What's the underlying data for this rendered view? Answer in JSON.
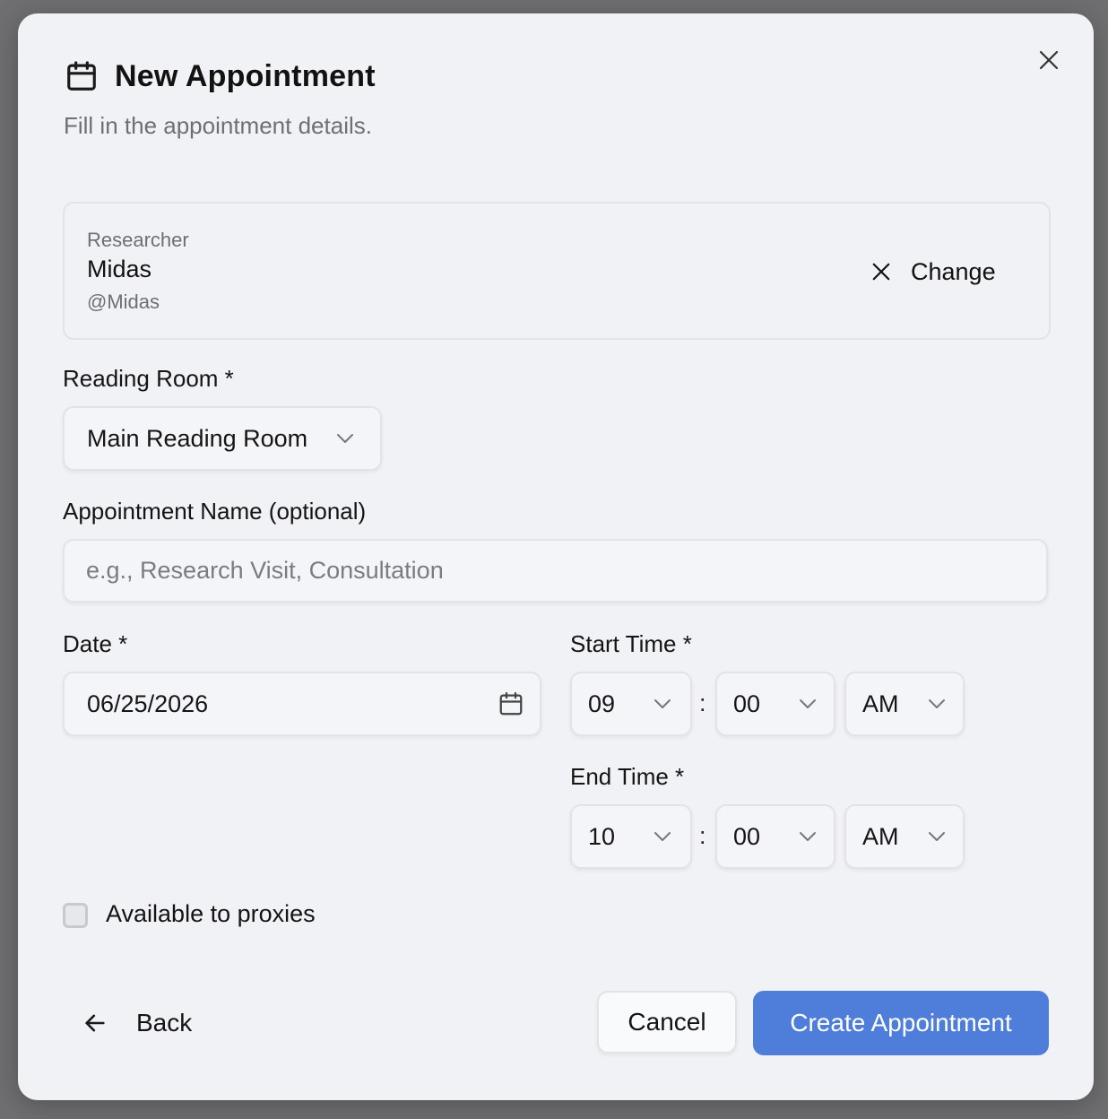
{
  "dialog": {
    "title": "New Appointment",
    "subtitle": "Fill in the appointment details."
  },
  "researcher": {
    "label": "Researcher",
    "name": "Midas",
    "handle": "@Midas",
    "change_label": "Change"
  },
  "reading_room": {
    "label": "Reading Room *",
    "selected": "Main Reading Room"
  },
  "appointment_name": {
    "label": "Appointment Name (optional)",
    "value": "",
    "placeholder": "e.g., Research Visit, Consultation"
  },
  "date": {
    "label": "Date *",
    "value": "06/25/2026"
  },
  "start_time": {
    "label": "Start Time *",
    "hour": "09",
    "separator": ":",
    "minute": "00",
    "period": "AM"
  },
  "end_time": {
    "label": "End Time *",
    "hour": "10",
    "separator": ":",
    "minute": "00",
    "period": "AM"
  },
  "proxies": {
    "label": "Available to proxies",
    "checked": false
  },
  "footer": {
    "back_label": "Back",
    "cancel_label": "Cancel",
    "create_label": "Create Appointment"
  },
  "colors": {
    "primary": "#4e7ed9",
    "background": "#f1f2f5",
    "muted_text": "#6e6f74"
  }
}
